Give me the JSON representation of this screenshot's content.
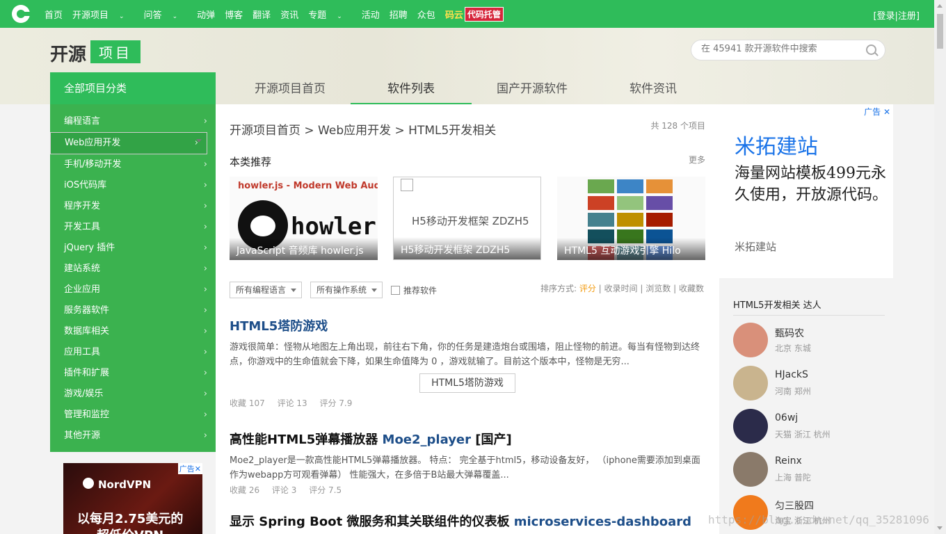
{
  "topnav": {
    "items": [
      "首页",
      "开源项目",
      "问答",
      "动弹",
      "博客",
      "翻译",
      "资讯",
      "专题",
      "活动",
      "招聘",
      "众包"
    ],
    "caret": "⌄",
    "myun": "码云",
    "dmtg": "代码托管",
    "login": "[登录|注册]"
  },
  "brand": {
    "name": "开源",
    "tag": "项目"
  },
  "search": {
    "placeholder": "在 45941 款开源软件中搜索"
  },
  "tabs": [
    "开源项目首页",
    "软件列表",
    "国产开源软件",
    "软件资讯"
  ],
  "sidebar": {
    "title": "全部项目分类",
    "items": [
      "编程语言",
      "Web应用开发",
      "手机/移动开发",
      "iOS代码库",
      "程序开发",
      "开发工具",
      "jQuery 插件",
      "建站系统",
      "企业应用",
      "服务器软件",
      "数据库相关",
      "应用工具",
      "插件和扩展",
      "游戏/娱乐",
      "管理和监控",
      "其他开源"
    ],
    "arrow": "›"
  },
  "ad_left": {
    "mark": "广告",
    "close": "✕",
    "brand": "NordVPN",
    "line1": "以每月2.75美元的",
    "line2": "超低价VPN"
  },
  "main": {
    "breadcrumb": "开源项目首页 > Web应用开发 > HTML5开发相关",
    "count": "共 128 个项目",
    "rec_title": "本类推荐",
    "more": "更多",
    "cards": [
      {
        "caption": "JavaScript 音频库 howler.js",
        "headline": "howler.js - Modern Web Audio J",
        "word": "howler."
      },
      {
        "caption": "H5移动开发框架 ZDZH5",
        "alt": "H5移动开发框架 ZDZH5"
      },
      {
        "caption": "HTML5 互动游戏引擎 Hilo"
      }
    ],
    "filters": {
      "lang": "所有编程语言",
      "os": "所有操作系统",
      "recommend": "推荐软件"
    },
    "sort": {
      "label": "排序方式:",
      "options": [
        "评分",
        "收录时间",
        "浏览数",
        "收藏数"
      ],
      "sep": "|"
    },
    "items": [
      {
        "title": "HTML5塔防游戏",
        "desc": "游戏很简单：怪物从地图左上角出现，前往右下角，你的任务是建造炮台或围墙，阻止怪物的前进。每当有怪物到达终点，你游戏中的生命值就会下降，如果生命值降为 0 ，游戏就输了。目前这个版本中，怪物是无穷...",
        "img_alt": "HTML5塔防游戏",
        "fav": "收藏 107",
        "comments": "评论 13",
        "score": "评分 7.9"
      },
      {
        "title": "高性能HTML5弹幕播放器",
        "title_name": "Moe2_player",
        "title_tag": "[国产]",
        "desc": "Moe2_player是一款高性能HTML5弹幕播放器。 特点： 完全基于html5，移动设备友好， （iphone需要添加到桌面作为webapp方可观看弹幕） 性能强大，在多倍于B站最大弹幕覆盖...",
        "fav": "收藏 26",
        "comments": "评论 3",
        "score": "评分 7.5"
      },
      {
        "title": "显示 Spring Boot 微服务和其关联组件的仪表板",
        "title_name": "microservices-dashboard"
      }
    ]
  },
  "ad_right": {
    "mark": "广告",
    "close": "✕",
    "title": "米拓建站",
    "body": "海量网站模板499元永久使用，开放源代码。",
    "brand": "米拓建站"
  },
  "experts": {
    "title": "HTML5开发相关 达人",
    "people": [
      {
        "name": "甄码农",
        "loc": "北京 东城",
        "color": "#d9907a"
      },
      {
        "name": "HJackS",
        "loc": "河南 郑州",
        "color": "#c9b48e"
      },
      {
        "name": "06wj",
        "loc": "天猫 浙江 杭州",
        "color": "#2b2b4a"
      },
      {
        "name": "Reinx",
        "loc": "上海 普陀",
        "color": "#8a7a6a"
      },
      {
        "name": "匀三股四",
        "loc": "淘宝 浙江 杭州",
        "color": "#f07a1c"
      }
    ]
  },
  "watermark": "https://blog.csdn.net/qq_35281096"
}
